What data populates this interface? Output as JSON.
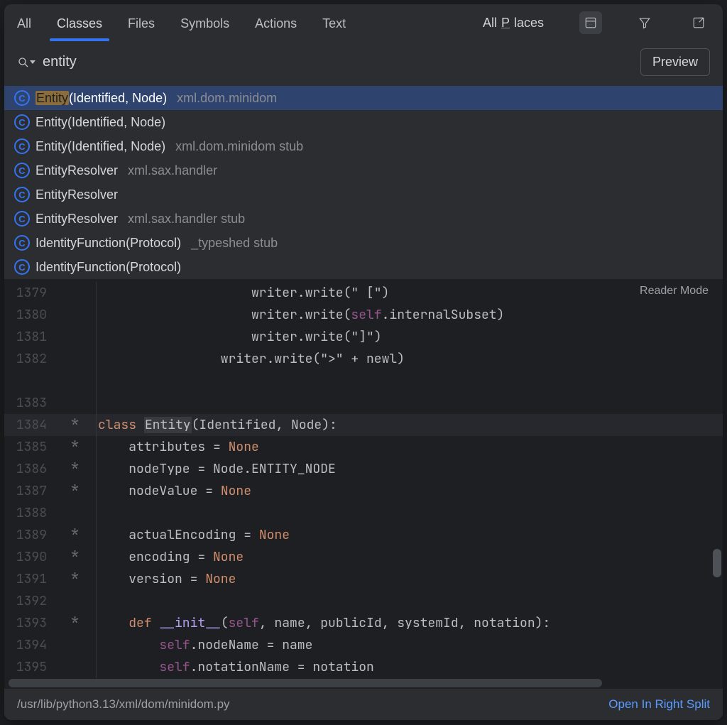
{
  "tabs": [
    "All",
    "Classes",
    "Files",
    "Symbols",
    "Actions",
    "Text"
  ],
  "active_tab_index": 1,
  "scope_label_prefix": "All ",
  "scope_label_underlined": "P",
  "scope_label_suffix": "laces",
  "search_value": "entity",
  "preview_label": "Preview",
  "reader_mode_label": "Reader Mode",
  "results": [
    {
      "highlight": "Entity",
      "rest": "(Identified, Node)",
      "location": "xml.dom.minidom",
      "selected": true
    },
    {
      "highlight": "",
      "rest": "Entity(Identified, Node)",
      "location": "",
      "selected": false
    },
    {
      "highlight": "",
      "rest": "Entity(Identified, Node)",
      "location": "xml.dom.minidom stub",
      "selected": false
    },
    {
      "highlight": "",
      "rest": "EntityResolver",
      "location": "xml.sax.handler",
      "selected": false
    },
    {
      "highlight": "",
      "rest": "EntityResolver",
      "location": "",
      "selected": false
    },
    {
      "highlight": "",
      "rest": "EntityResolver",
      "location": "xml.sax.handler stub",
      "selected": false
    },
    {
      "highlight": "",
      "rest": "IdentityFunction(Protocol)",
      "location": "_typeshed stub",
      "selected": false
    },
    {
      "highlight": "",
      "rest": "IdentityFunction(Protocol)",
      "location": "",
      "selected": false
    }
  ],
  "code": [
    {
      "n": "1379",
      "mark": "",
      "hl": false,
      "tokens": [
        [
          "",
          "                    writer.write("
        ],
        [
          "",
          "\" [\""
        ],
        [
          "",
          ")"
        ]
      ]
    },
    {
      "n": "1380",
      "mark": "",
      "hl": false,
      "tokens": [
        [
          "",
          "                    writer.write("
        ],
        [
          "self",
          "self"
        ],
        [
          "",
          ".internalSubset)"
        ]
      ]
    },
    {
      "n": "1381",
      "mark": "",
      "hl": false,
      "tokens": [
        [
          "",
          "                    writer.write("
        ],
        [
          "",
          "\"]\""
        ],
        [
          "",
          ")"
        ]
      ]
    },
    {
      "n": "1382",
      "mark": "",
      "hl": false,
      "tokens": [
        [
          "",
          "                writer.write("
        ],
        [
          "",
          "\">\""
        ],
        [
          "",
          ""
        ],
        [
          "",
          " + newl)"
        ]
      ]
    },
    {
      "n": "",
      "mark": "",
      "hl": false,
      "tokens": [
        [
          "",
          ""
        ]
      ]
    },
    {
      "n": "1383",
      "mark": "",
      "hl": false,
      "tokens": [
        [
          "",
          ""
        ]
      ]
    },
    {
      "n": "1384",
      "mark": "*",
      "hl": true,
      "tokens": [
        [
          "kw",
          "class "
        ],
        [
          "decl",
          "Entity"
        ],
        [
          "",
          "(Identified, Node):"
        ]
      ]
    },
    {
      "n": "1385",
      "mark": "*",
      "hl": false,
      "tokens": [
        [
          "",
          "    attributes = "
        ],
        [
          "const",
          "None"
        ]
      ]
    },
    {
      "n": "1386",
      "mark": "*",
      "hl": false,
      "tokens": [
        [
          "",
          "    nodeType = Node.ENTITY_NODE"
        ]
      ]
    },
    {
      "n": "1387",
      "mark": "*",
      "hl": false,
      "tokens": [
        [
          "",
          "    nodeValue = "
        ],
        [
          "const",
          "None"
        ]
      ]
    },
    {
      "n": "1388",
      "mark": "",
      "hl": false,
      "tokens": [
        [
          "",
          ""
        ]
      ]
    },
    {
      "n": "1389",
      "mark": "*",
      "hl": false,
      "tokens": [
        [
          "",
          "    actualEncoding = "
        ],
        [
          "const",
          "None"
        ]
      ]
    },
    {
      "n": "1390",
      "mark": "*",
      "hl": false,
      "tokens": [
        [
          "",
          "    encoding = "
        ],
        [
          "const",
          "None"
        ]
      ]
    },
    {
      "n": "1391",
      "mark": "*",
      "hl": false,
      "tokens": [
        [
          "",
          "    version = "
        ],
        [
          "const",
          "None"
        ]
      ]
    },
    {
      "n": "1392",
      "mark": "",
      "hl": false,
      "tokens": [
        [
          "",
          ""
        ]
      ]
    },
    {
      "n": "1393",
      "mark": "*",
      "hl": false,
      "tokens": [
        [
          "",
          "    "
        ],
        [
          "kw",
          "def "
        ],
        [
          "fn",
          "__init__"
        ],
        [
          "",
          "("
        ],
        [
          "self",
          "self"
        ],
        [
          "",
          ", name, publicId, systemId, notation):"
        ]
      ]
    },
    {
      "n": "1394",
      "mark": "",
      "hl": false,
      "tokens": [
        [
          "",
          "        "
        ],
        [
          "self",
          "self"
        ],
        [
          "",
          ".nodeName = name"
        ]
      ]
    },
    {
      "n": "1395",
      "mark": "",
      "hl": false,
      "tokens": [
        [
          "",
          "        "
        ],
        [
          "self",
          "self"
        ],
        [
          "",
          ".notationName = notation"
        ]
      ]
    }
  ],
  "status_path": "/usr/lib/python3.13/xml/dom/minidom.py",
  "open_split_label": "Open In Right Split"
}
